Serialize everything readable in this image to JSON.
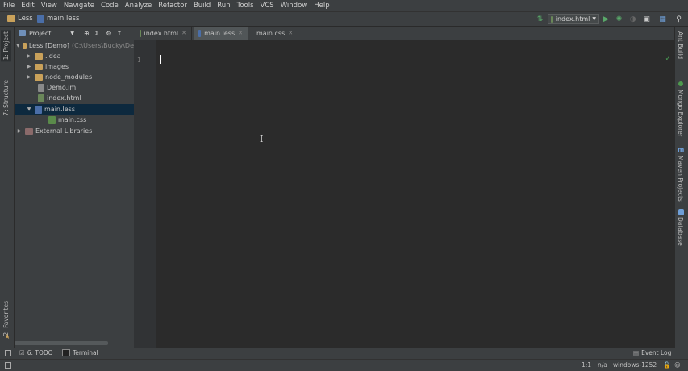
{
  "menu": [
    "File",
    "Edit",
    "View",
    "Navigate",
    "Code",
    "Analyze",
    "Refactor",
    "Build",
    "Run",
    "Tools",
    "VCS",
    "Window",
    "Help"
  ],
  "breadcrumb": {
    "project": "Less",
    "file": "main.less"
  },
  "run_config": {
    "label": "index.html"
  },
  "project_panel": {
    "title": "Project",
    "tree": [
      {
        "label": "Less [Demo]",
        "detail": "(C:\\Users\\Bucky\\De"
      },
      {
        "label": ".idea"
      },
      {
        "label": "images"
      },
      {
        "label": "node_modules"
      },
      {
        "label": "Demo.iml"
      },
      {
        "label": "index.html"
      },
      {
        "label": "main.less"
      },
      {
        "label": "main.css"
      },
      {
        "label": "External Libraries"
      }
    ]
  },
  "editor_tabs": [
    {
      "label": "index.html",
      "active": false
    },
    {
      "label": "main.less",
      "active": true
    },
    {
      "label": "main.css",
      "active": false
    }
  ],
  "editor": {
    "line_numbers": [
      "1"
    ]
  },
  "left_stripe": {
    "project": "1: Project",
    "structure": "7: Structure",
    "favorites": "2: Favorites"
  },
  "right_stripe": {
    "ant": "Ant Build",
    "mongo": "Mongo Explorer",
    "maven": "Maven Projects",
    "database": "Database"
  },
  "bottom_tabs": {
    "todo": "6: TODO",
    "terminal": "Terminal",
    "event_log": "Event Log"
  },
  "status": {
    "position": "1:1",
    "na": "n/a",
    "encoding": "windows-1252"
  },
  "colors": {
    "accent_run": "#59a869",
    "selection": "#0d293e",
    "check": "#499c54"
  }
}
